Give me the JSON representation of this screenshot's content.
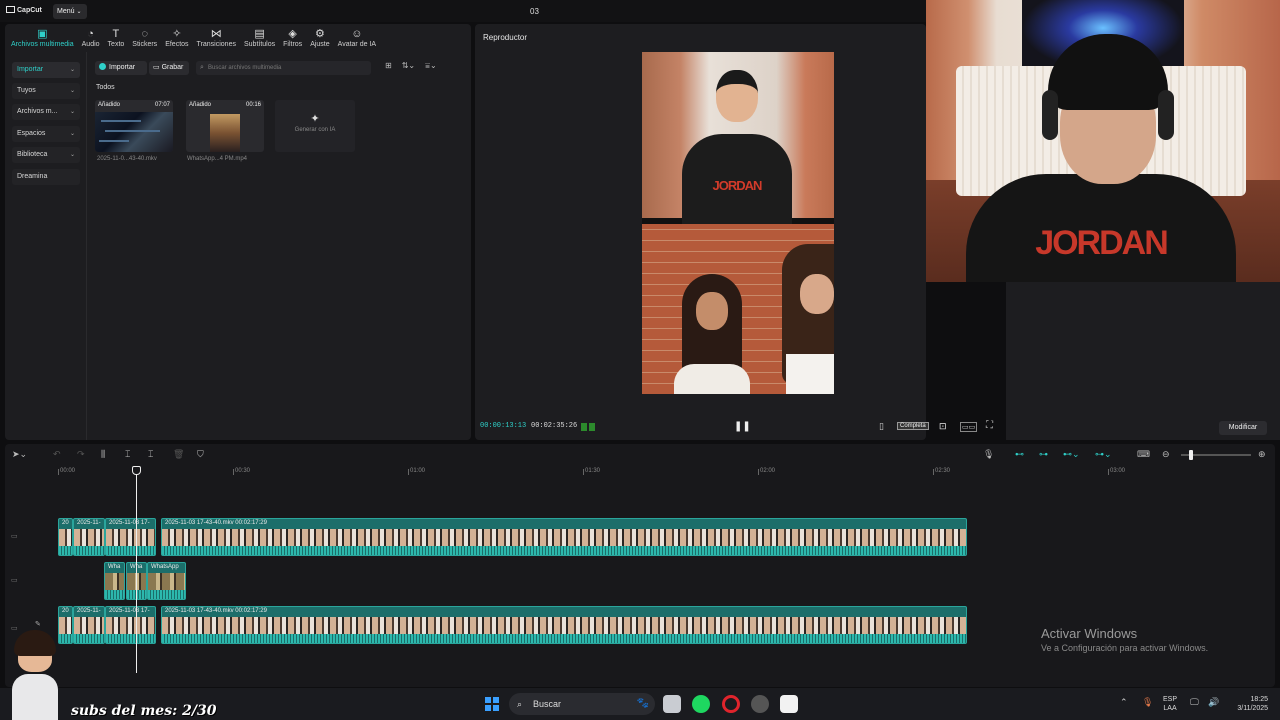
{
  "app": {
    "logo": "CapCut",
    "menu_label": "Menú",
    "project_title": "03"
  },
  "toolbar": [
    {
      "label": "Archivos multimedia",
      "icon": "media-icon"
    },
    {
      "label": "Audio",
      "icon": "audio-icon"
    },
    {
      "label": "Texto",
      "icon": "text-icon"
    },
    {
      "label": "Stickers",
      "icon": "sticker-icon"
    },
    {
      "label": "Efectos",
      "icon": "effects-icon"
    },
    {
      "label": "Transiciones",
      "icon": "transition-icon"
    },
    {
      "label": "Subtítulos",
      "icon": "subtitles-icon"
    },
    {
      "label": "Filtros",
      "icon": "filters-icon"
    },
    {
      "label": "Ajuste",
      "icon": "adjust-icon"
    },
    {
      "label": "Avatar de IA",
      "icon": "avatar-icon"
    }
  ],
  "categories": [
    "Importar",
    "Tuyos",
    "Archivos m...",
    "Espacios",
    "Biblioteca",
    "Dreamina"
  ],
  "media": {
    "import_label": "Importar",
    "record_label": "Grabar",
    "search_placeholder": "Buscar archivos multimedia",
    "section": "Todos",
    "items": [
      {
        "badge": "Añadido",
        "duration": "07:07",
        "name": "2025-11-0...43-40.mkv"
      },
      {
        "badge": "Añadido",
        "duration": "00:16",
        "name": "WhatsApp...4 PM.mp4"
      }
    ],
    "generate_label": "Generar con IA"
  },
  "player": {
    "title": "Reproductor",
    "current_time": "00:00:13:13",
    "total_time": "00:02:35:26",
    "fullscreen_label": "Completa",
    "video_caption": "JORDAN"
  },
  "right_panel": {
    "modify_label": "Modificar"
  },
  "timeline": {
    "ruler": [
      "00:00",
      "00:30",
      "01:00",
      "01:30",
      "02:00",
      "02:30",
      "03:00"
    ],
    "main_clips": [
      {
        "label": "20"
      },
      {
        "label": "2025-11-"
      },
      {
        "label": "2025-11-03 17-"
      },
      {
        "label": "2025-11-03 17-43-40.mkv  00:02:17:29"
      }
    ],
    "overlay_clips": [
      {
        "label": "Wha"
      },
      {
        "label": "Wha"
      },
      {
        "label": "WhatsApp"
      }
    ],
    "bottom_clips": [
      {
        "label": "20"
      },
      {
        "label": "2025-11-"
      },
      {
        "label": "2025-11-03 17-"
      },
      {
        "label": "2025-11-03 17-43-40.mkv  00:02:17:29"
      }
    ]
  },
  "watermark": {
    "title": "Activar Windows",
    "subtitle": "Ve a Configuración para activar Windows."
  },
  "taskbar": {
    "search_label": "Buscar",
    "lang_top": "ESP",
    "lang_bottom": "LAA",
    "time": "18:25",
    "date": "3/11/2025"
  },
  "overlay": {
    "subs_text": "subs del mes: 2/30"
  },
  "colors": {
    "accent": "#2fd0c9",
    "clip": "#1c6e6a"
  }
}
